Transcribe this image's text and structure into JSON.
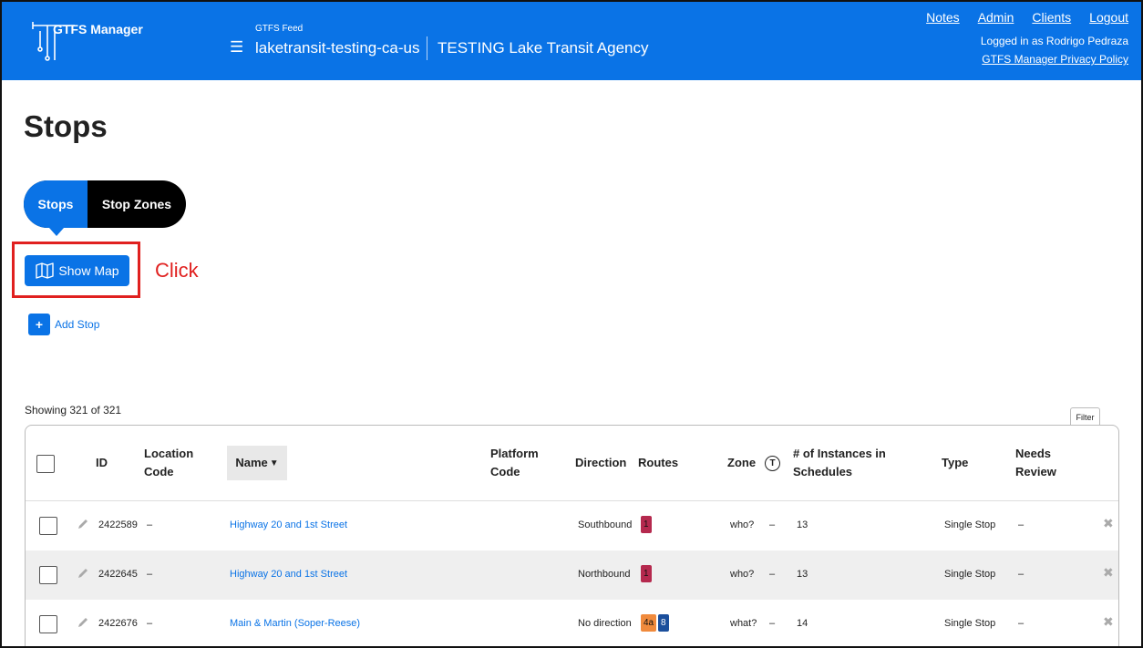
{
  "header": {
    "logo_text": "GTFS Manager",
    "feed_label": "GTFS Feed",
    "feed_name": "laketransit-testing-ca-us",
    "agency_name": "TESTING Lake Transit Agency",
    "links": [
      "Notes",
      "Admin",
      "Clients",
      "Logout"
    ],
    "logged_in": "Logged in as Rodrigo Pedraza",
    "privacy_link": "GTFS Manager Privacy Policy",
    "menu_icon": "hamburger-icon"
  },
  "page": {
    "title": "Stops"
  },
  "tabs": [
    {
      "label": "Stops",
      "active": true
    },
    {
      "label": "Stop Zones",
      "active": false
    }
  ],
  "actions": {
    "show_map_label": "Show Map",
    "annotation_label": "Click",
    "add_stop_label": "Add Stop"
  },
  "table_meta": {
    "showing": "Showing 321 of 321",
    "filter_label": "Filter"
  },
  "table": {
    "columns": {
      "id": "ID",
      "location_code_1": "Location",
      "location_code_2": "Code",
      "name": "Name",
      "platform_code_1": "Platform",
      "platform_code_2": "Code",
      "direction": "Direction",
      "routes": "Routes",
      "zone": "Zone",
      "zone_icon_letter": "T",
      "instances_1": "# of Instances in",
      "instances_2": "Schedules",
      "type": "Type",
      "needs_review_1": "Needs",
      "needs_review_2": "Review"
    },
    "rows": [
      {
        "id": "2422589",
        "location_code": "–",
        "name": "Highway 20 and 1st Street",
        "direction": "Southbound",
        "routes": [
          {
            "label": "1",
            "color": "#b5294e"
          }
        ],
        "zone": "who?",
        "zone_extra": "–",
        "instances": "13",
        "type": "Single Stop",
        "needs_review": "–"
      },
      {
        "id": "2422645",
        "location_code": "–",
        "name": "Highway 20 and 1st Street",
        "direction": "Northbound",
        "routes": [
          {
            "label": "1",
            "color": "#b5294e"
          }
        ],
        "zone": "who?",
        "zone_extra": "–",
        "instances": "13",
        "type": "Single Stop",
        "needs_review": "–"
      },
      {
        "id": "2422676",
        "location_code": "–",
        "name": "Main & Martin (Soper-Reese)",
        "direction": "No direction",
        "routes": [
          {
            "label": "4a",
            "color": "#f08a3c"
          },
          {
            "label": "8",
            "color": "#1b4f9c"
          }
        ],
        "zone": "what?",
        "zone_extra": "–",
        "instances": "14",
        "type": "Single Stop",
        "needs_review": "–"
      }
    ]
  },
  "colors": {
    "primary": "#0a73e6",
    "annotation": "#e0201f",
    "tab_bg": "#000000"
  }
}
